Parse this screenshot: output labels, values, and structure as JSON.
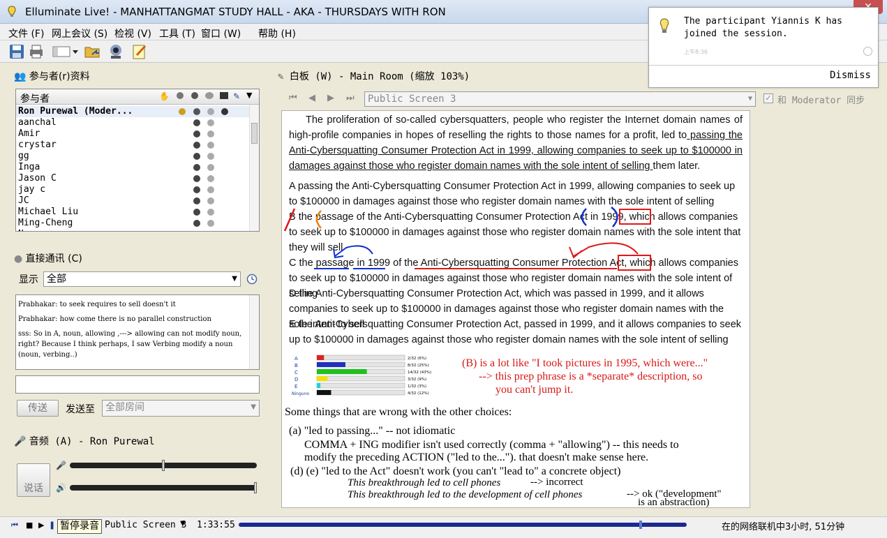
{
  "window": {
    "title": "Elluminate Live! - MANHATTANGMAT STUDY HALL - AKA - THURSDAYS WITH RON"
  },
  "menu": [
    "文件 (F)",
    "网上会议 (S)",
    "检视 (V)",
    "工具 (T)",
    "窗口 (W)",
    "帮助 (H)"
  ],
  "participants": {
    "header": "参与者(r)资料",
    "column_label": "参与者",
    "list": [
      "Ron Purewal (Moder...",
      "aanchal",
      "Amir",
      "crystar",
      "gg",
      "Inga",
      "Jason C",
      "jay c",
      "JC",
      "Michael Liu",
      "Ming-Cheng",
      "N"
    ]
  },
  "chat": {
    "header": "直接通讯 (C)",
    "display_label": "显示",
    "display_value": "全部",
    "messages": [
      "Prabhakar: to seek requires to sell doesn't it",
      "Prabhakar: how come there is no parallel construction",
      "sss: So in A, noun, allowing ,---> allowing can not modify noun, right? Because I think perhaps, I saw Verbing modify a noun (noun, verbing..)"
    ],
    "send_button": "传送",
    "send_to_label": "发送至",
    "send_to_value": "全部房间"
  },
  "audio": {
    "header": "音频 (A) - Ron Purewal",
    "talk_button": "说话",
    "mic_level": 0.5,
    "speaker_level": 1.0
  },
  "whiteboard": {
    "header": "白板 (W) - Main Room (缩放 103%)",
    "screen_select": "Public Screen 3",
    "sync_label": "和 Moderator 同步"
  },
  "question": {
    "stem_start": "The proliferation of so-called cybersquatters, people who register the Internet domain names of high-profile companies in hopes of reselling the rights to those names for a profit, led to",
    "stem_underlined": " passing the Anti-Cybersquatting Consumer Protection Act in 1999, allowing companies to seek up to $100000 in damages against those who register domain names with the sole intent of selling ",
    "stem_end": "them later.",
    "choices": [
      "A   passing the Anti-Cybersquatting Consumer Protection Act in 1999, allowing companies to seek up to $100000 in damages against those who register domain names with the sole intent of selling",
      "B the passage of the Anti-Cybersquatting Consumer Protection Act in 1999, which allows companies to seek up to $100000 in damages against those who register domain names with the sole intent that they will sell",
      "C the passage in 1999 of the Anti-Cybersquatting Consumer Protection Act, which allows companies to seek up to $100000 in damages against those who register domain names with the sole intent of selling",
      "D the Anti-Cybersquatting Consumer Protection Act, which was passed in 1999, and it allows companies to seek up to $100000 in damages against those who register domain names with the sole intent to sell",
      "E the Anti-Cybersquatting Consumer Protection Act, passed in 1999, and it allows companies to seek up to $100000 in damages against those who register domain names with the sole intent of selling"
    ]
  },
  "poll": {
    "chart_data": {
      "type": "bar",
      "categories": [
        "A",
        "B",
        "C",
        "D",
        "E",
        "Ninguno"
      ],
      "values": [
        2,
        8,
        14,
        3,
        1,
        4
      ],
      "labels": [
        "2/32 (6%)",
        "8/32 (25%)",
        "14/32 (43%)",
        "3/32 (9%)",
        "1/32 (3%)",
        "4/32 (12%)"
      ],
      "total": 32,
      "colors": [
        "#e02020",
        "#2030c0",
        "#20c020",
        "#f0e010",
        "#20d0e0",
        "#111111"
      ]
    }
  },
  "annotation": [
    "(B) is a lot like \"I took pictures in 1995, which were...\"",
    "--> this prep phrase is a *separate* description, so",
    "you can't jump it."
  ],
  "notes": {
    "heading": "Some things that are wrong with the other choices:",
    "a1": "(a) \"led to passing...\" -- not idiomatic",
    "a2": "COMMA + ING modifier isn't used correctly (comma + \"allowing\") -- this needs to",
    "a3": "modify the preceding ACTION (\"led to the...\").  that doesn't make sense here.",
    "d1": "(d) (e) \"led to the Act\" doesn't work  (you can't \"lead to\" a concrete object)",
    "ex1": "This breakthrough led to cell phones",
    "ex1b": "--> incorrect",
    "ex2": "This breakthrough led to the development of cell phones",
    "ex2b": "--> ok (\"development\"",
    "ex2c": "is an abstraction)"
  },
  "notification": {
    "text1": "The participant Yiannis K has",
    "text2": "joined the session.",
    "time": "上午8:36",
    "dismiss": "Dismiss"
  },
  "status": {
    "record_tooltip": "暂停录音",
    "screen": "Public Screen 3",
    "time": "1:33:55",
    "playback_progress": 0.9,
    "online": "在的网络联机中3小时, 51分钟"
  }
}
